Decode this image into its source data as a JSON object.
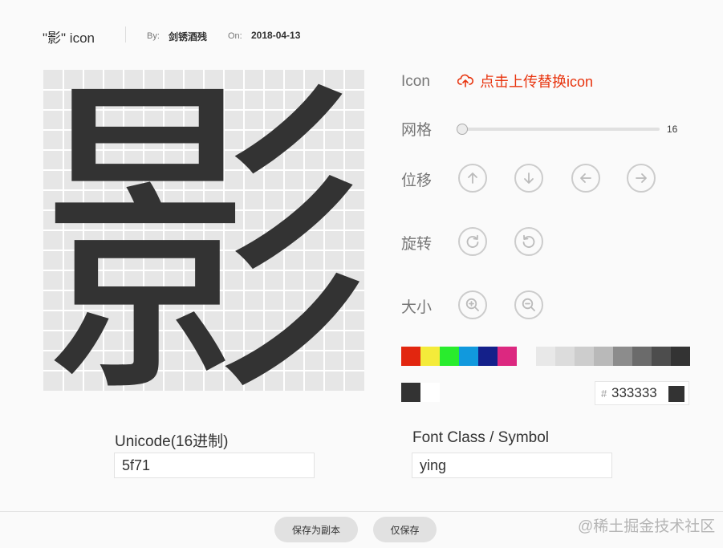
{
  "header": {
    "title": "\"影\" icon",
    "by_label": "By:",
    "by_value": "剑锈酒残",
    "on_label": "On:",
    "on_value": "2018-04-13"
  },
  "preview": {
    "glyph": "影",
    "glyph_color": "#333333",
    "grid_color": "#ffffff",
    "background_color": "#e6e6e6"
  },
  "controls": {
    "icon_label": "Icon",
    "upload_label": "点击上传替换icon",
    "upload_icon": "cloud-upload-icon",
    "grid_label": "网格",
    "grid_value": "16",
    "move_label": "位移",
    "move_buttons": [
      "arrow-up-icon",
      "arrow-down-icon",
      "arrow-left-icon",
      "arrow-right-icon"
    ],
    "rotate_label": "旋转",
    "rotate_buttons": [
      "rotate-clockwise-icon",
      "rotate-counterclockwise-icon"
    ],
    "size_label": "大小",
    "size_buttons": [
      "zoom-in-icon",
      "zoom-out-icon"
    ]
  },
  "palette": {
    "primary_colors": [
      "#e2260f",
      "#f4eb3a",
      "#29ec2d",
      "#1199dd",
      "#14208a",
      "#dc2880"
    ],
    "gray_colors": [
      "#e8e8e8",
      "#dcdcdc",
      "#cdcdcd",
      "#b9b9b9",
      "#8c8c8c",
      "#6b6b6b",
      "#4d4d4d",
      "#333333"
    ],
    "current_color": "#333333",
    "secondary_color": "#ffffff",
    "hex_prefix": "#",
    "hex_value": "333333"
  },
  "fields": {
    "unicode_label": "Unicode(16进制)",
    "unicode_value": "5f71",
    "font_class_label": "Font Class / Symbol",
    "font_class_value": "ying"
  },
  "footer": {
    "save_copy_label": "保存为副本",
    "save_only_label": "仅保存",
    "watermark": "@稀土掘金技术社区"
  }
}
